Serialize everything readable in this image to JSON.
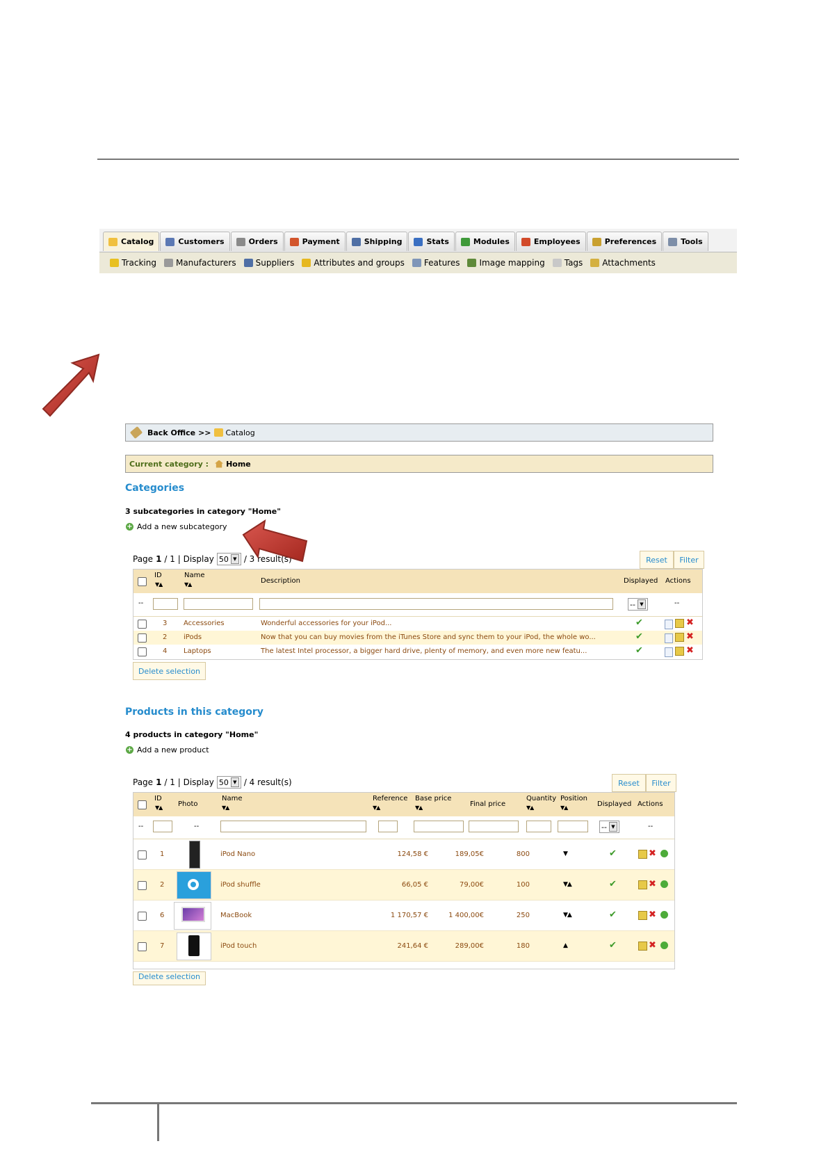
{
  "nav": {
    "tabs": [
      {
        "label": "Catalog",
        "icon": "folder-icon",
        "color": "#f0c040"
      },
      {
        "label": "Customers",
        "icon": "user-icon",
        "color": "#5b78b4"
      },
      {
        "label": "Orders",
        "icon": "cart-icon",
        "color": "#8a8a8a"
      },
      {
        "label": "Payment",
        "icon": "payment-icon",
        "color": "#d2552c"
      },
      {
        "label": "Shipping",
        "icon": "truck-icon",
        "color": "#4f6fa5"
      },
      {
        "label": "Stats",
        "icon": "chart-icon",
        "color": "#3a6fc2"
      },
      {
        "label": "Modules",
        "icon": "puzzle-icon",
        "color": "#3f9a3a"
      },
      {
        "label": "Employees",
        "icon": "employee-icon",
        "color": "#d24a2a"
      },
      {
        "label": "Preferences",
        "icon": "preferences-icon",
        "color": "#c9a030"
      },
      {
        "label": "Tools",
        "icon": "wrench-icon",
        "color": "#7d8ea8"
      }
    ],
    "subitems": [
      {
        "label": "Tracking",
        "icon": "tracking-icon",
        "color": "#e8c020"
      },
      {
        "label": "Manufacturers",
        "icon": "gear-icon",
        "color": "#9a9a9a"
      },
      {
        "label": "Suppliers",
        "icon": "truck-icon",
        "color": "#4f6fa5"
      },
      {
        "label": "Attributes and groups",
        "icon": "star-icon",
        "color": "#e6b820"
      },
      {
        "label": "Features",
        "icon": "eye-icon",
        "color": "#7f96b8"
      },
      {
        "label": "Image mapping",
        "icon": "image-icon",
        "color": "#5f8a3a"
      },
      {
        "label": "Tags",
        "icon": "cloud-icon",
        "color": "#c8c8c8"
      },
      {
        "label": "Attachments",
        "icon": "attachment-icon",
        "color": "#d4b040"
      }
    ]
  },
  "breadcrumb": {
    "root": "Back Office",
    "sep": ">>",
    "current": "Catalog"
  },
  "current_category": {
    "label": "Current category :",
    "value": "Home"
  },
  "categories": {
    "title": "Categories",
    "count_text": "3 subcategories in category \"Home\"",
    "add_link": "Add a new subcategory",
    "pager": {
      "page": "Page",
      "page_num": "1",
      "page_total": "/ 1 | Display",
      "per_page": "50",
      "result_text": "/ 3 result(s)"
    },
    "reset": "Reset",
    "filter": "Filter",
    "headers": {
      "id": "ID",
      "name": "Name",
      "description": "Description",
      "displayed": "Displayed",
      "actions": "Actions"
    },
    "filter_placeholder": "--",
    "filter_select": "--",
    "rows": [
      {
        "id": "3",
        "name": "Accessories",
        "description": "Wonderful accessories for your iPod..."
      },
      {
        "id": "2",
        "name": "iPods",
        "description": "Now that you can buy movies from the iTunes Store and sync them to your iPod, the whole wo..."
      },
      {
        "id": "4",
        "name": "Laptops",
        "description": "The latest Intel processor, a bigger hard drive, plenty of memory, and even more new featu..."
      }
    ],
    "delete": "Delete selection"
  },
  "products": {
    "title": "Products in this category",
    "count_text": "4 products in category \"Home\"",
    "add_link": "Add a new product",
    "pager": {
      "page": "Page",
      "page_num": "1",
      "page_total": "/ 1 | Display",
      "per_page": "50",
      "result_text": "/ 4 result(s)"
    },
    "reset": "Reset",
    "filter": "Filter",
    "headers": {
      "id": "ID",
      "photo": "Photo",
      "name": "Name",
      "reference": "Reference",
      "base_price": "Base price",
      "final_price": "Final price",
      "quantity": "Quantity",
      "position": "Position",
      "displayed": "Displayed",
      "actions": "Actions"
    },
    "filter_placeholder": "--",
    "filter_select": "--",
    "rows": [
      {
        "id": "1",
        "name": "iPod Nano",
        "base": "124,58 €",
        "final": "189,05€",
        "qty": "800",
        "position": "▼",
        "photo": "nano"
      },
      {
        "id": "2",
        "name": "iPod shuffle",
        "base": "66,05 €",
        "final": "79,00€",
        "qty": "100",
        "position": "▼▲",
        "photo": "shuffle"
      },
      {
        "id": "6",
        "name": "MacBook",
        "base": "1 170,57 €",
        "final": "1 400,00€",
        "qty": "250",
        "position": "▼▲",
        "photo": "macbook"
      },
      {
        "id": "7",
        "name": "iPod touch",
        "base": "241,64 €",
        "final": "289,00€",
        "qty": "180",
        "position": "▲",
        "photo": "touch"
      }
    ],
    "delete": "Delete selection"
  },
  "colors": {
    "heading": "#268ccd",
    "row_text": "#8b4a10",
    "arrow": "#c0392b"
  }
}
